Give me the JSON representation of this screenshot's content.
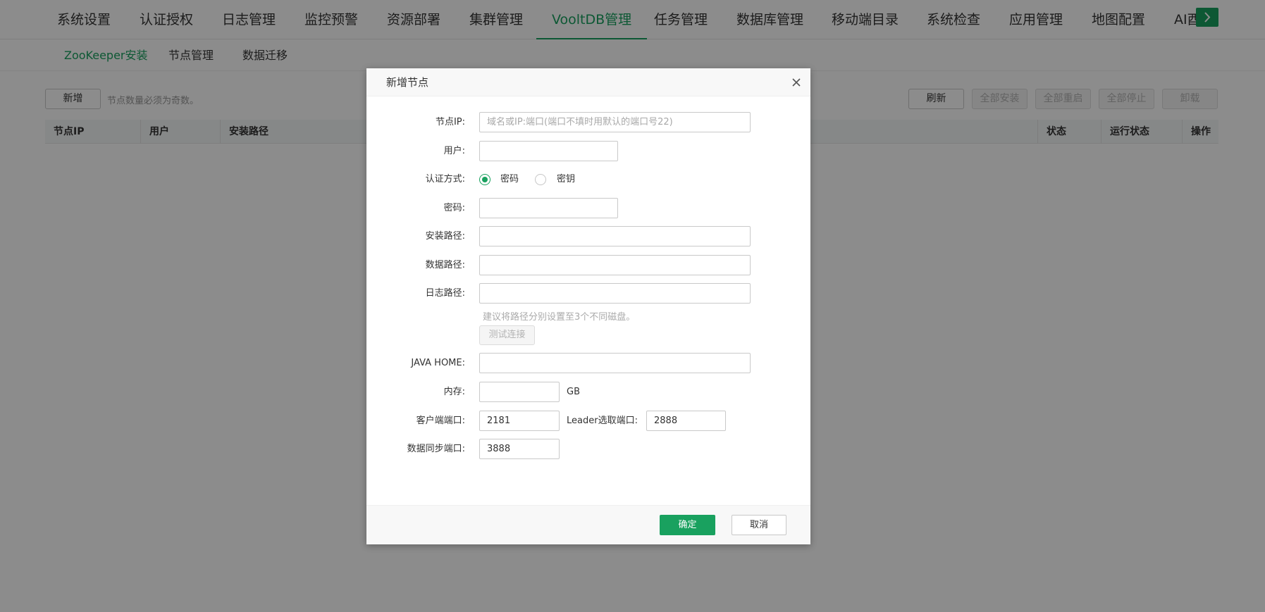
{
  "topnav": {
    "tabs": [
      "系统设置",
      "认证授权",
      "日志管理",
      "监控预警",
      "资源部署",
      "集群管理",
      "VooltDB管理",
      "任务管理",
      "数据库管理",
      "移动端目录",
      "系统检查",
      "应用管理",
      "地图配置",
      "AI酉"
    ],
    "active_index": 6,
    "more_icon": "chevron-right-icon"
  },
  "subnav": {
    "tabs": [
      "ZooKeeper安装",
      "节点管理",
      "数据迁移"
    ],
    "active_index": 0
  },
  "toolbar": {
    "add_label": "新增",
    "hint": "节点数量必须为奇数。",
    "refresh_label": "刷新",
    "install_all_label": "全部安装",
    "restart_all_label": "全部重启",
    "stop_all_label": "全部停止",
    "uninstall_label": "卸载"
  },
  "table": {
    "columns": [
      "节点IP",
      "用户",
      "安装路径",
      "状态",
      "运行状态",
      "操作"
    ]
  },
  "dialog": {
    "title": "新增节点",
    "close_icon": "close-icon",
    "fields": {
      "node_ip": {
        "label": "节点IP:",
        "value": "",
        "placeholder": "域名或IP:端口(端口不填时用默认的端口号22)"
      },
      "user": {
        "label": "用户:",
        "value": ""
      },
      "auth": {
        "label": "认证方式:",
        "options": [
          "密码",
          "密钥"
        ],
        "selected": "密码"
      },
      "password": {
        "label": "密码:",
        "value": ""
      },
      "install_path": {
        "label": "安装路径:",
        "value": ""
      },
      "data_path": {
        "label": "数据路径:",
        "value": ""
      },
      "log_path": {
        "label": "日志路径:",
        "value": ""
      },
      "path_hint": "建议将路径分别设置至3个不同磁盘。",
      "test_button": "测试连接",
      "java_home": {
        "label": "JAVA HOME:",
        "value": ""
      },
      "memory": {
        "label": "内存:",
        "value": "",
        "unit": "GB"
      },
      "client_port": {
        "label": "客户端端口:",
        "value": "2181"
      },
      "leader_port": {
        "label": "Leader选取端口:",
        "value": "2888"
      },
      "sync_port": {
        "label": "数据同步端口:",
        "value": "3888"
      }
    },
    "confirm_label": "确定",
    "cancel_label": "取消"
  },
  "colors": {
    "accent": "#19a15f",
    "mask": "rgba(0,0,0,0.45)"
  }
}
